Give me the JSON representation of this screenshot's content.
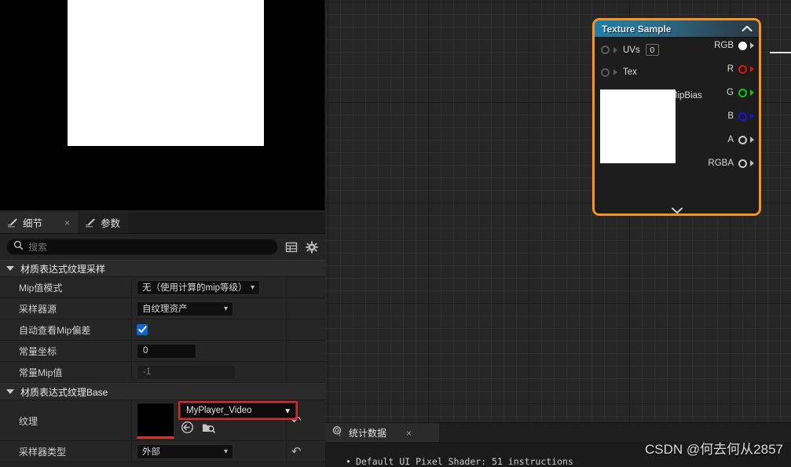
{
  "preview": {
    "name": "material-preview-viewport"
  },
  "details_panel": {
    "tabs": [
      {
        "label": "细节",
        "icon": "pen-icon",
        "active": true,
        "closable": true,
        "close_label": "×"
      },
      {
        "label": "参数",
        "icon": "pen-icon",
        "active": false,
        "closable": false
      }
    ],
    "search": {
      "placeholder": "搜索",
      "value": "",
      "icon": "search-icon"
    },
    "toolbar_icons": [
      {
        "name": "table-view-icon"
      },
      {
        "name": "settings-gear-icon"
      }
    ],
    "categories": [
      {
        "label": "材质表达式纹理采样",
        "expanded": true,
        "rows": [
          {
            "label": "Mip值模式",
            "type": "combo",
            "value": "无（使用计算的mip等级）"
          },
          {
            "label": "采样器源",
            "type": "combo",
            "value": "自纹理资产"
          },
          {
            "label": "自动查看Mip偏差",
            "type": "checkbox",
            "value": true
          },
          {
            "label": "常量坐标",
            "type": "text",
            "value": "0"
          },
          {
            "label": "常量Mip值",
            "type": "text-muted",
            "value": "-1"
          }
        ]
      },
      {
        "label": "材质表达式纹理Base",
        "expanded": true,
        "rows": [
          {
            "label": "纹理",
            "type": "asset",
            "value": "MyPlayer_Video",
            "highlighted": true,
            "highlight_color": "#f02020",
            "thumb_accent": "#d4362b",
            "icons": [
              {
                "name": "browse-to-asset-icon"
              },
              {
                "name": "find-in-content-browser-icon"
              }
            ],
            "reset_icon": "reset-to-default-icon"
          },
          {
            "label": "采样器类型",
            "type": "combo",
            "value": "外部"
          }
        ]
      }
    ]
  },
  "graph": {
    "node": {
      "title": "Texture Sample",
      "selected": true,
      "selection_color": "#f59423",
      "collapse_icon": "chevron-up-icon",
      "expand_icon": "chevron-down-icon",
      "inputs": [
        {
          "label": "UVs",
          "default_value": "0",
          "connected": false
        },
        {
          "label": "Tex",
          "connected": false
        },
        {
          "label": "Apply View MipBias",
          "connected": false
        }
      ],
      "outputs": [
        {
          "label": "RGB",
          "color": "#ffffff",
          "connected": true
        },
        {
          "label": "R",
          "color": "#e01414",
          "connected": false
        },
        {
          "label": "G",
          "color": "#15c415",
          "connected": false
        },
        {
          "label": "B",
          "color": "#1414e0",
          "connected": false
        },
        {
          "label": "A",
          "color": "#c9c9c9",
          "connected": false
        },
        {
          "label": "RGBA",
          "color": "#c9c9c9",
          "connected": false
        }
      ]
    }
  },
  "stats_panel": {
    "tab": {
      "label": "统计数据",
      "icon": "stats-icon",
      "close_label": "×"
    },
    "lines": [
      "Default UI Pixel Shader: 51 instructions"
    ]
  },
  "watermark": {
    "text": "CSDN @何去何从2857"
  }
}
